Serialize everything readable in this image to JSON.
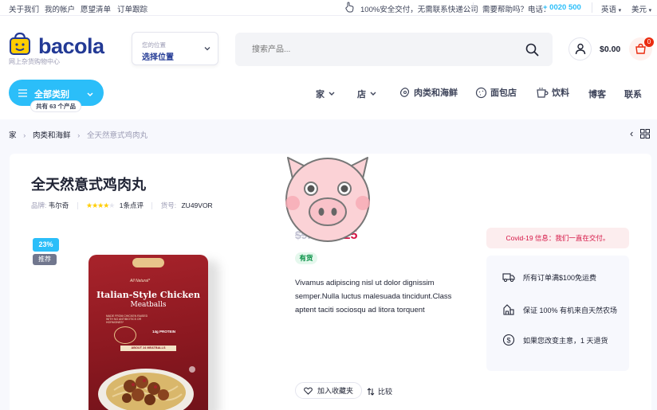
{
  "topbar": {
    "links": [
      "关于我们",
      "我的帐户",
      "愿望清单",
      "订单跟踪"
    ],
    "secure_text": "100%安全交付，无需联系快递公司",
    "help_text": "需要帮助吗？电话：",
    "phone": "+ 0020 500",
    "language": "英语",
    "currency": "美元"
  },
  "header": {
    "logo_text": "bacola",
    "logo_sub": "网上杂货购物中心",
    "location_label": "您的位置",
    "location_value": "选择位置",
    "search_placeholder": "搜索产品...",
    "cart_total": "$0.00",
    "cart_count": "0"
  },
  "nav": {
    "all_categories": "全部类别",
    "product_count": "共有 63 个产品",
    "items": [
      "家",
      "店",
      "肉类和海鲜",
      "面包店",
      "饮料",
      "博客",
      "联系"
    ]
  },
  "breadcrumb": {
    "home": "家",
    "category": "肉类和海鲜",
    "current": "全天然意式鸡肉丸"
  },
  "product": {
    "title": "全天然意式鸡肉丸",
    "brand_label": "品牌:",
    "brand": "韦尔奇",
    "rating_stars": 4,
    "reviews": "1条点评",
    "sku_label": "货号:",
    "sku": "ZU49VOR",
    "discount_badge": "23%",
    "recommend_badge": "推荐",
    "old_price": "$9.35",
    "new_price": "$7.25",
    "stock": "有货",
    "description": "Vivamus adipiscing nisl ut dolor dignissim semper.Nulla luctus malesuada tincidunt.Class aptent taciti sociosqu ad litora torquent",
    "wishlist": "加入收藏夹",
    "compare": "比较",
    "package": {
      "brand_top": "All Natural*",
      "name_line1": "Italian-Style Chicken",
      "name_line2": "Meatballs",
      "claim": "MADE FROM CHICKEN RAISED WITH NO ANTIBIOTICS OR HORMONES*",
      "protein": "14g PROTEIN",
      "count": "ABOUT 24 MEATBALLS"
    }
  },
  "sidebar": {
    "covid_notice": "Covid-19 信息：我们一直在交付。",
    "features": [
      "所有订单满$100免运费",
      "保证 100% 有机来自天然农场",
      "如果您改变主意，1 天退货"
    ]
  },
  "colors": {
    "accent": "#2bbef9",
    "brand": "#233a95",
    "price": "#d51243",
    "in_stock": "#038e42"
  }
}
